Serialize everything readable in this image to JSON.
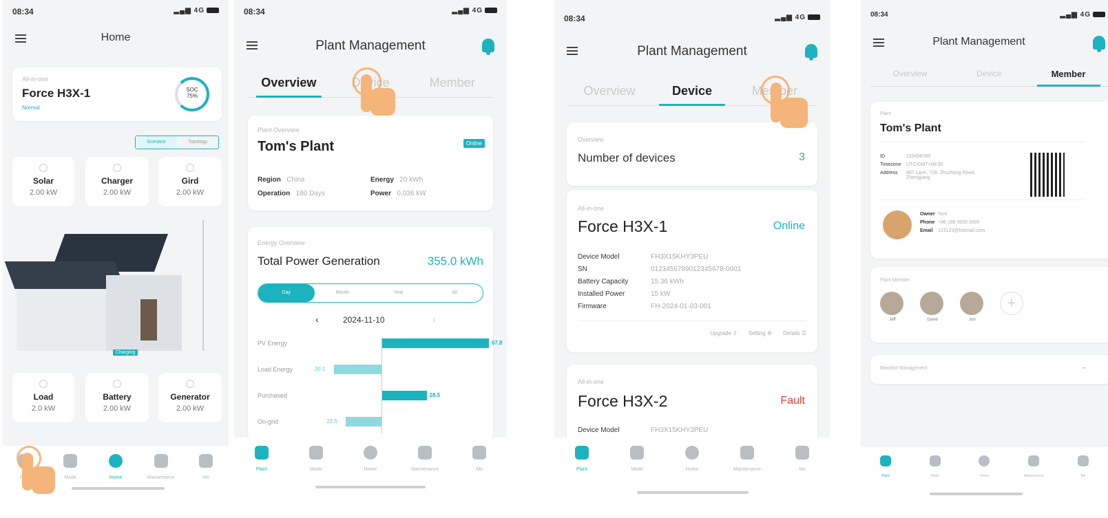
{
  "status": {
    "time": "08:34",
    "network": "4G"
  },
  "screen1": {
    "title": "Home",
    "device_card": {
      "category": "All-in-one",
      "name": "Force H3X-1",
      "state": "Normal",
      "soc_label": "SOC",
      "soc_value": "75%"
    },
    "view_toggle": {
      "options": [
        "Scenario",
        "Topology"
      ],
      "selected": "Scenario"
    },
    "tiles": [
      {
        "name": "Solar",
        "value": "2.00 kW"
      },
      {
        "name": "Charger",
        "value": "2.00 kW"
      },
      {
        "name": "Gird",
        "value": "2.00 kW"
      },
      {
        "name": "Load",
        "value": "2.0 kW"
      },
      {
        "name": "Battery",
        "value": "2.00 kW"
      },
      {
        "name": "Generator",
        "value": "2.00 kW"
      }
    ],
    "battery_state": "Charging",
    "nav": [
      {
        "label": "Plant",
        "icon": "plant-icon"
      },
      {
        "label": "Mode",
        "icon": "mode-icon"
      },
      {
        "label": "Home",
        "icon": "home-globe-icon"
      },
      {
        "label": "Maintenance",
        "icon": "maintenance-shield-icon"
      },
      {
        "label": "Me",
        "icon": "me-person-icon"
      }
    ]
  },
  "screen2": {
    "title": "Plant Management",
    "tabs": [
      "Overview",
      "Device",
      "Member"
    ],
    "plant": {
      "label": "Plant Overview",
      "name": "Tom's Plant",
      "status": "Online",
      "region_label": "Region",
      "region": "China",
      "operation_label": "Operation",
      "operation": "180 Days",
      "energy_label": "Energy",
      "energy": "20 kWh",
      "power_label": "Power",
      "power": "0.036 kW"
    },
    "energy": {
      "label": "Energy Overview",
      "title": "Total Power Generation",
      "total": "355.0 kWh",
      "periods": [
        "Day",
        "Month",
        "Year",
        "All"
      ],
      "date": "2024-11-10"
    },
    "chart_data": {
      "type": "bar",
      "categories": [
        "PV Energy",
        "Load Energy",
        "Purchased",
        "On-grid"
      ],
      "values": [
        67.8,
        -30.1,
        28.5,
        -22.5
      ],
      "colors": [
        "#1cb3bf",
        "#8fd9df",
        "#1cb3bf",
        "#8fd9df"
      ]
    },
    "nav": [
      "Plant",
      "Mode",
      "Home",
      "Maintenance",
      "Me"
    ]
  },
  "screen3": {
    "title": "Plant Management",
    "tabs": [
      "Overview",
      "Device",
      "Member"
    ],
    "overview": {
      "label": "Overview",
      "text": "Number of devices",
      "count": "3"
    },
    "devices": [
      {
        "category": "All-in-one",
        "name": "Force H3X-1",
        "status": "Online",
        "model_label": "Device Model",
        "model": "FH3X15KHY3PEU",
        "sn_label": "SN",
        "sn": "0123456789012345678-0001",
        "capacity_label": "Battery Capacity",
        "capacity": "15.36 kWh",
        "power_label": "Installed Power",
        "power": "15 kW",
        "fw_label": "Firmware",
        "fw": "FH-2024-01-03-001",
        "actions": [
          "Upgrade",
          "Setting",
          "Details"
        ]
      },
      {
        "category": "All-in-one",
        "name": "Force H3X-2",
        "status": "Fault",
        "model_label": "Device Model",
        "model": "FH3X15KHY3PEU"
      }
    ],
    "nav": [
      "Plant",
      "Mode",
      "Home",
      "Maintenance",
      "Me"
    ]
  },
  "screen4": {
    "title": "Plant Management",
    "tabs": [
      "Overview",
      "Device",
      "Member"
    ],
    "plant": {
      "label": "Plant",
      "name": "Tom's Plant",
      "id_label": "ID",
      "id": "123456789",
      "tz_label": "Timezone",
      "tz": "UTC/GMT+08:00",
      "addr_label": "Address",
      "addr": "887 Lane, 728, Zhuzhong Road, Zhengjiang"
    },
    "owner": {
      "owner_label": "Owner",
      "owner": "Tom",
      "phone_label": "Phone",
      "phone": "+86 188 0000 0000",
      "email_label": "Email",
      "email": "123123@hotmail.com"
    },
    "members": {
      "label": "Plant Member",
      "names": [
        "Jeff",
        "David",
        "Jon"
      ]
    },
    "blacklist": "Blacklist Management",
    "nav": [
      "Plant",
      "Mode",
      "Home",
      "Maintenance",
      "Me"
    ]
  }
}
